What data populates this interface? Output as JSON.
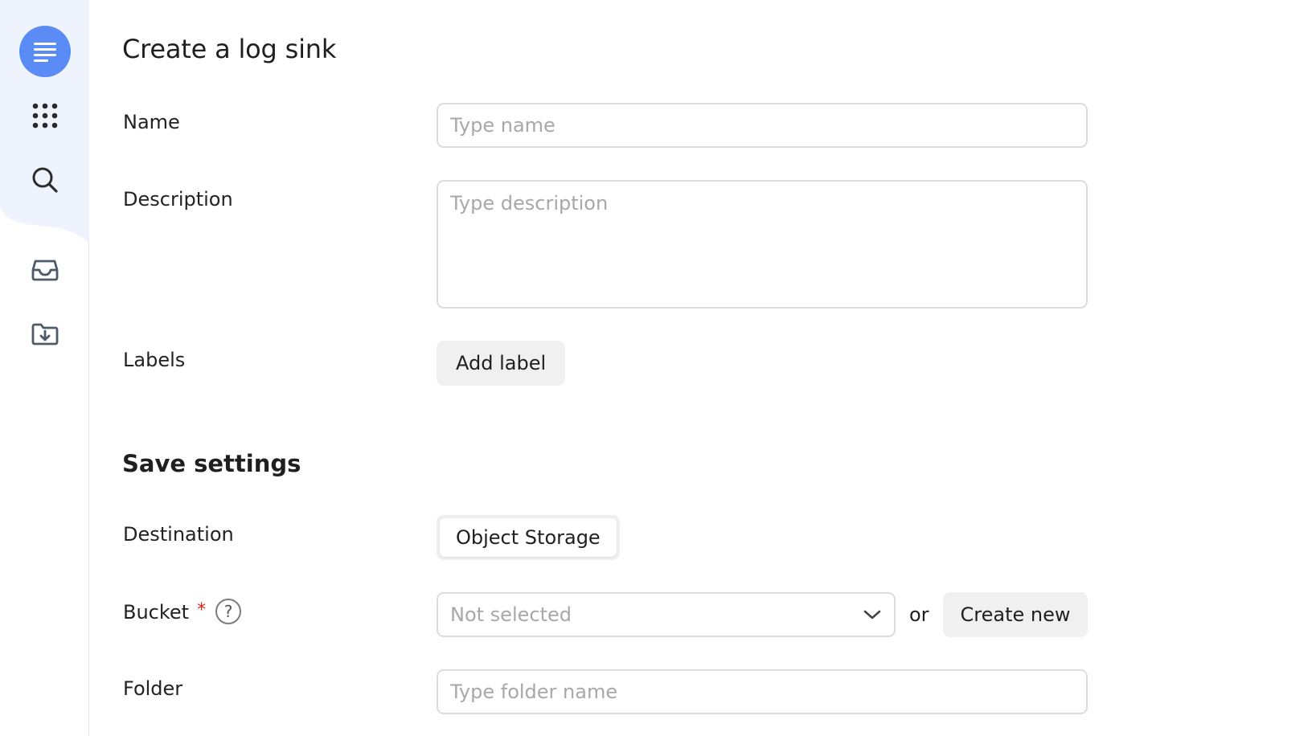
{
  "sidebar": {
    "items": [
      {
        "icon": "logs-icon",
        "active": true
      },
      {
        "icon": "services-grid-icon",
        "active": false
      },
      {
        "icon": "search-icon",
        "active": false
      },
      {
        "icon": "inbox-icon",
        "active": false
      },
      {
        "icon": "folder-download-icon",
        "active": false
      }
    ],
    "accent_color": "#5b8cf6",
    "panel_color": "#eef3fe"
  },
  "form": {
    "title": "Create a log sink",
    "name": {
      "label": "Name",
      "placeholder": "Type name",
      "value": ""
    },
    "description": {
      "label": "Description",
      "placeholder": "Type description",
      "value": ""
    },
    "labels": {
      "label": "Labels",
      "button": "Add label"
    },
    "save_settings": {
      "title": "Save settings",
      "destination": {
        "label": "Destination",
        "selected": "Object Storage"
      },
      "bucket": {
        "label": "Bucket",
        "required_mark": "*",
        "help": "?",
        "select_value": "Not selected",
        "or": "or",
        "create_button": "Create new"
      },
      "folder": {
        "label": "Folder",
        "placeholder": "Type folder name",
        "value": ""
      }
    }
  }
}
